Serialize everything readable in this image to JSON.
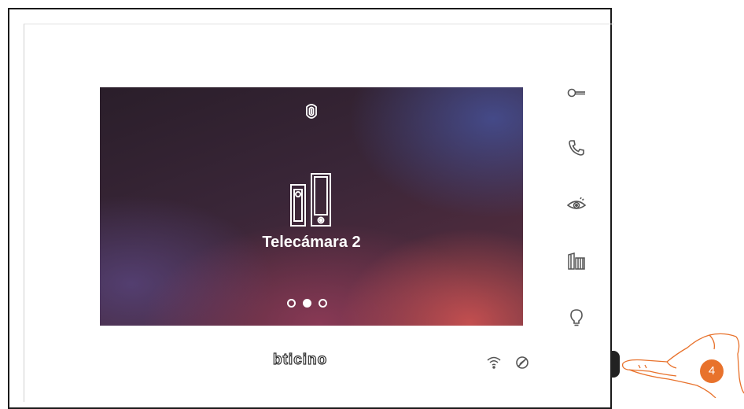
{
  "screen": {
    "title": "Telecámara 2",
    "pager": {
      "count": 3,
      "active_index": 1
    }
  },
  "sidebar": {
    "buttons": [
      {
        "icon": "key-icon",
        "name": "door-lock-button"
      },
      {
        "icon": "phone-icon",
        "name": "call-button"
      },
      {
        "icon": "eye-icon",
        "name": "camera-view-button"
      },
      {
        "icon": "gate-icon",
        "name": "gate-button"
      },
      {
        "icon": "lightbulb-icon",
        "name": "light-button"
      }
    ]
  },
  "footer": {
    "brand": "bticino",
    "status_icons": [
      "wifi-icon",
      "do-not-disturb-icon"
    ]
  },
  "annotation": {
    "step": "4"
  },
  "colors": {
    "accent": "#e8722c",
    "icon": "#555555"
  }
}
